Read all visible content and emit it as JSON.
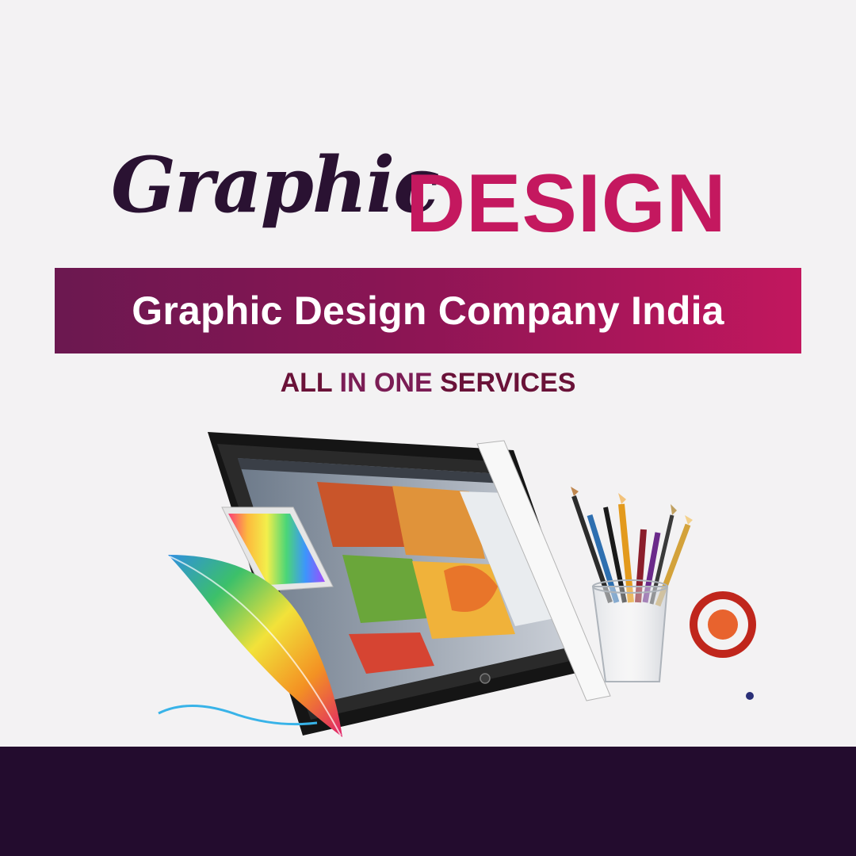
{
  "header": {
    "title_script": "Graphic",
    "title_caps": "DESIGN"
  },
  "banner": {
    "text": "Graphic Design Company India"
  },
  "tagline": {
    "part1": "ALL",
    "part2": "IN ONE",
    "part3": "SERVICES"
  },
  "illustration": {
    "icons": [
      "tablet-icon",
      "feather-icon",
      "pencil-cup-icon",
      "target-icon"
    ]
  },
  "colors": {
    "background": "#f3f2f3",
    "accent_magenta": "#c4185f",
    "title_dark": "#2a1232",
    "banner_start": "#6b1850",
    "banner_end": "#c2175e",
    "footer": "#230c2e",
    "target_red": "#c0261c",
    "target_orange": "#e8632e"
  }
}
